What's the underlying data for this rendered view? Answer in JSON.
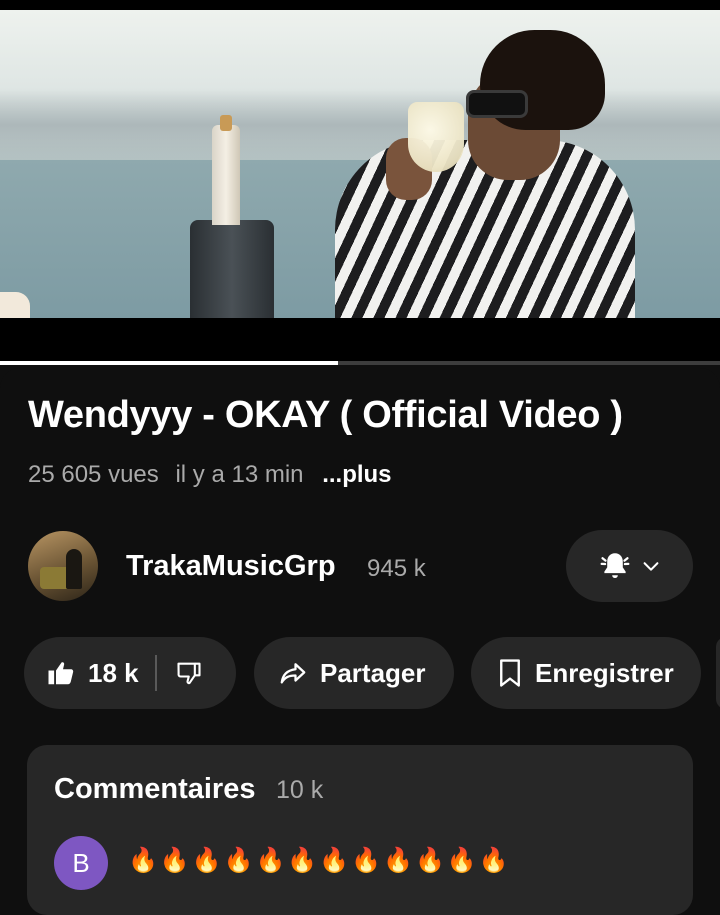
{
  "video": {
    "progress_fraction": 0.47
  },
  "title": "Wendyyy - OKAY  ( Official Video )",
  "meta": {
    "views": "25 605 vues",
    "time_ago": "il y a 13 min",
    "more_label": "...plus"
  },
  "channel": {
    "name": "TrakaMusicGrp",
    "subscribers": "945 k"
  },
  "actions": {
    "like_count": "18 k",
    "share_label": "Partager",
    "save_label": "Enregistrer"
  },
  "comments": {
    "heading": "Commentaires",
    "count": "10 k",
    "top_comment": {
      "avatar_letter": "B",
      "text": "🔥🔥🔥🔥🔥🔥🔥🔥🔥🔥🔥🔥"
    }
  },
  "icons": {
    "like": "thumbs-up-icon",
    "dislike": "thumbs-down-icon",
    "share": "share-arrow-icon",
    "save": "bookmark-icon",
    "bell": "bell-icon",
    "chevron": "chevron-down-icon"
  },
  "colors": {
    "background": "#0f0f0f",
    "surface": "#272727",
    "secondary_text": "#aaaaaa",
    "comment_avatar": "#7e57c2"
  }
}
